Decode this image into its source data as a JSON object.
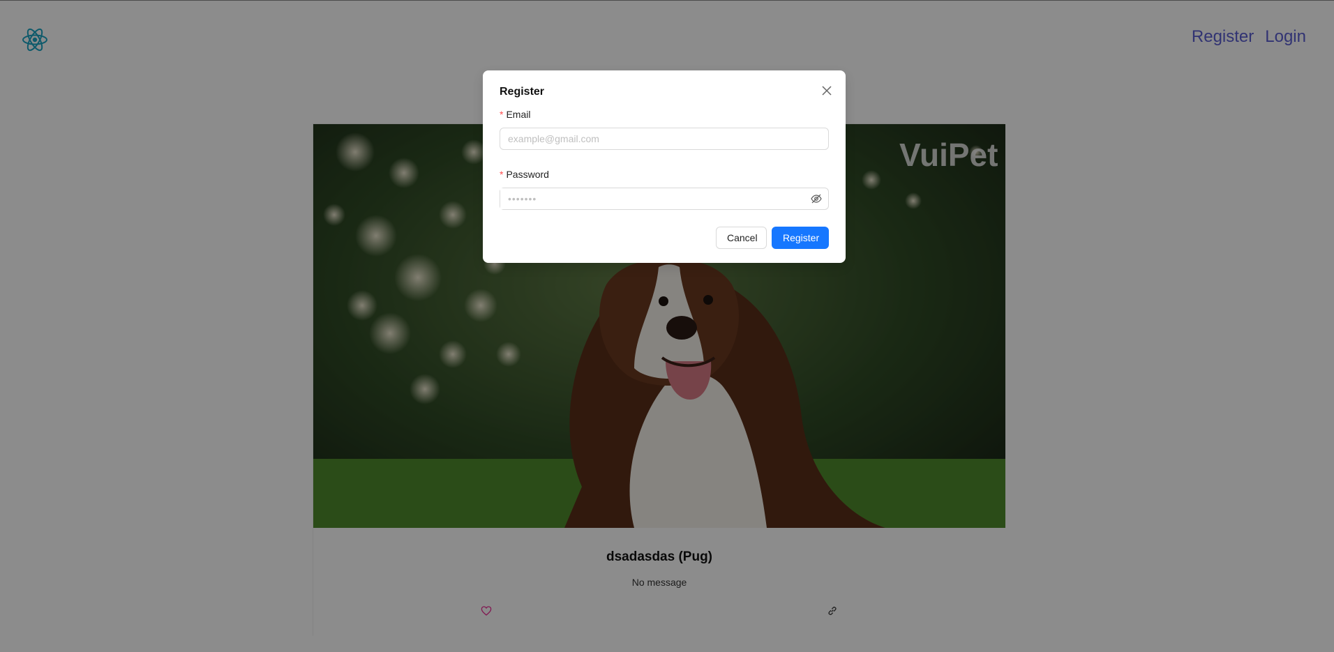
{
  "header": {
    "logo_icon": "react-atom-icon",
    "nav": {
      "register": "Register",
      "login": "Login"
    }
  },
  "card": {
    "image_watermark": "VuiPet",
    "title": "dsadasdas (Pug)",
    "message": "No message",
    "actions": {
      "like_icon": "heart-icon",
      "share_icon": "link-icon"
    }
  },
  "modal": {
    "title": "Register",
    "email": {
      "label": "Email",
      "placeholder": "example@gmail.com",
      "value": ""
    },
    "password": {
      "label": "Password",
      "placeholder": "•••••••",
      "value": ""
    },
    "cancel_label": "Cancel",
    "submit_label": "Register"
  },
  "colors": {
    "primary": "#1677ff",
    "nav_link": "#5a5ed1",
    "required": "#ff4d4f",
    "heart": "#eb2f96"
  }
}
